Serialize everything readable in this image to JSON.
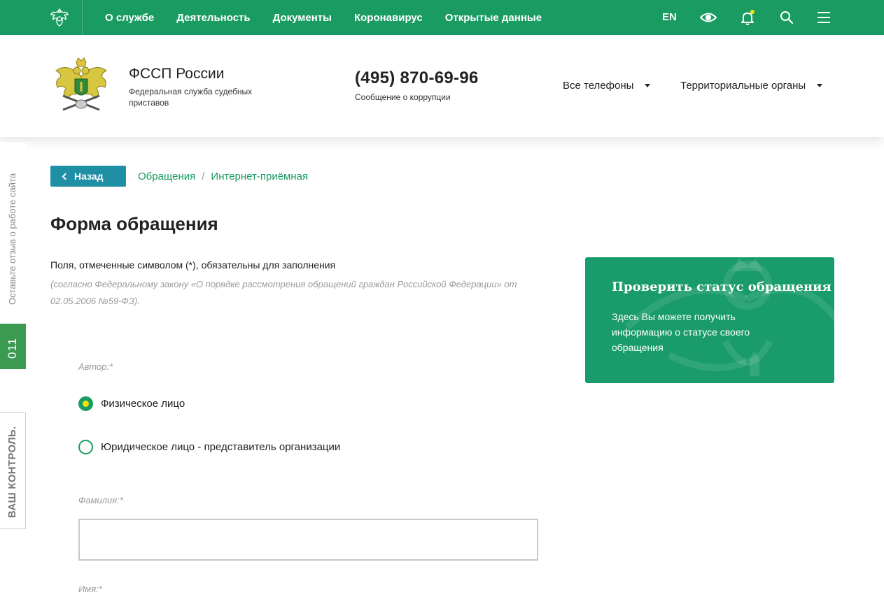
{
  "topnav": {
    "menu": [
      "О службе",
      "Деятельность",
      "Документы",
      "Коронавирус",
      "Открытые данные"
    ],
    "lang": "EN",
    "icons": [
      "emblem-icon",
      "eye-icon",
      "bell-icon",
      "search-icon",
      "menu-icon"
    ],
    "bg_color": "#1a9b62",
    "notification_dot_color": "#f5e10c"
  },
  "header": {
    "org_name": "ФССП России",
    "org_sub": "Федеральная служба судебных приставов",
    "phone": "(495) 870-69-96",
    "phone_sub": "Сообщение о коррупции",
    "dropdowns": [
      "Все телефоны",
      "Территориальные органы"
    ]
  },
  "side": {
    "feedback": "Оставьте отзыв о работе сайта",
    "code": "011",
    "control": "ВАШ КОНТРОЛЬ."
  },
  "breadcrumb": {
    "back": "Назад",
    "items": [
      "Обращения",
      "Интернет-приёмная"
    ]
  },
  "page": {
    "title": "Форма обращения",
    "required_note": "Поля, отмеченные символом (*), обязательны для заполнения",
    "law_note": "(согласно Федеральному закону «О порядке рассмотрения обращений граждан Российской Федерации» от 02.05.2006 №59-ФЗ)."
  },
  "status_card": {
    "title": "Проверить статус обращения",
    "text": "Здесь Вы можете получить информацию о статусе своего обращения",
    "bg_color": "#1a9b6b"
  },
  "form": {
    "author_label": "Автор:*",
    "author_options": [
      {
        "label": "Физическое лицо",
        "checked": true
      },
      {
        "label": "Юридическое лицо - представитель организации",
        "checked": false
      }
    ],
    "surname_label": "Фамилия:*",
    "surname_value": "",
    "name_label": "Имя:*"
  }
}
